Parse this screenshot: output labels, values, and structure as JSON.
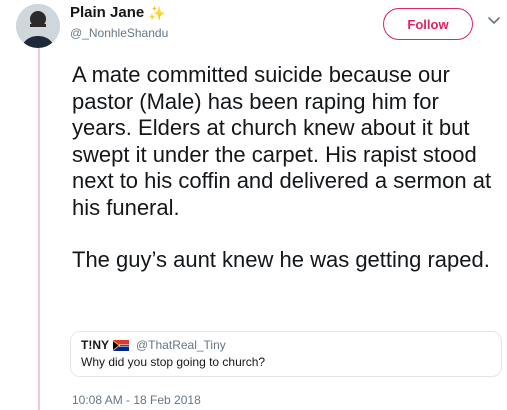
{
  "user": {
    "display_name": "Plain Jane",
    "handle": "@_NonhleShandu",
    "badge_icon": "sparkle-icon"
  },
  "actions": {
    "follow_label": "Follow",
    "menu_icon": "chevron-down-icon"
  },
  "tweet": {
    "paragraphs": [
      "A mate committed suicide because our pastor (Male) has been raping him for years. Elders at church knew about it but swept it under the carpet. His rapist stood next to his coffin and delivered a sermon at his funeral.",
      "The guy’s aunt knew he was getting raped."
    ],
    "timestamp": "10:08 AM - 18 Feb 2018"
  },
  "quoted": {
    "display_name": "T!NY",
    "flag_icon": "south-africa-flag-icon",
    "handle": "@ThatReal_Tiny",
    "text": "Why did you stop going to church?"
  },
  "colors": {
    "accent": "#e0245e",
    "thread_line": "#f0c8dc",
    "muted": "#657786"
  }
}
